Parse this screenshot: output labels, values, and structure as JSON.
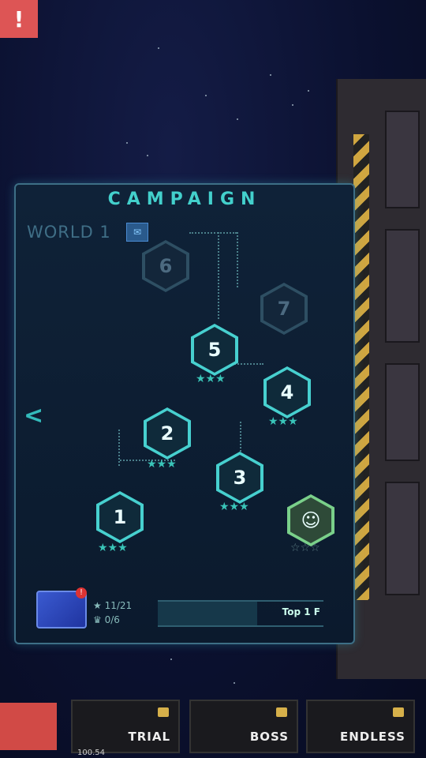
{
  "panel": {
    "title": "CAMPAIGN",
    "world_label": "WORLD 1",
    "back_icon": "chevron-left-icon"
  },
  "levels": [
    {
      "label": "1",
      "unlocked": true,
      "stars": 3
    },
    {
      "label": "2",
      "unlocked": true,
      "stars": 3
    },
    {
      "label": "3",
      "unlocked": true,
      "stars": 3
    },
    {
      "label": "4",
      "unlocked": true,
      "stars": 3
    },
    {
      "label": "5",
      "unlocked": true,
      "stars": 3
    },
    {
      "label": "6",
      "unlocked": false,
      "stars": 0
    },
    {
      "label": "7",
      "unlocked": false,
      "stars": 0
    }
  ],
  "rewards": {
    "badge": "!",
    "stars_count": "11/21",
    "trophy_count": "0/6",
    "progress_label": "Top 1 F"
  },
  "tabs": [
    {
      "label": "TRIAL"
    },
    {
      "label": "BOSS"
    },
    {
      "label": "ENDLESS"
    }
  ],
  "alert_label": "!",
  "currency": "100.54",
  "colors": {
    "accent": "#43d0cc",
    "alert": "#d55",
    "stripe": "#d0a640"
  }
}
